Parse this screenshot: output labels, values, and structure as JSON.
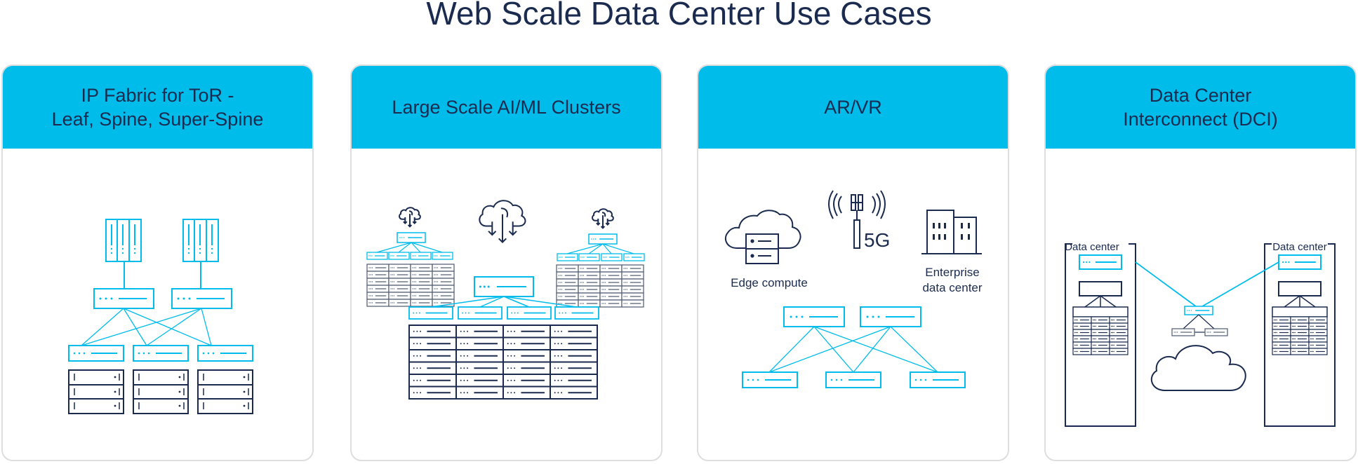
{
  "page": {
    "title": "Web Scale Data Center Use Cases"
  },
  "colors": {
    "header_bg": "#00bceb",
    "accent_cyan": "#00bceb",
    "navy": "#1b2b4f",
    "card_border": "#dedede",
    "gray_device": "#5a6578"
  },
  "cards": [
    {
      "title": "IP Fabric for ToR -\nLeaf, Spine, Super-Spine",
      "diagram": "leaf-spine-super-spine-topology"
    },
    {
      "title": "Large Scale AI/ML Clusters",
      "diagram": "ai-ml-cluster-topology"
    },
    {
      "title": "AR/VR",
      "diagram": "ar-vr-edge-topology",
      "labels": {
        "edge_compute": "Edge compute",
        "fiveg": "5G",
        "enterprise_line1": "Enterprise",
        "enterprise_line2": "data center"
      }
    },
    {
      "title": "Data Center\nInterconnect (DCI)",
      "diagram": "dci-topology",
      "labels": {
        "dc_left": "Data center",
        "dc_right": "Data center"
      }
    }
  ]
}
